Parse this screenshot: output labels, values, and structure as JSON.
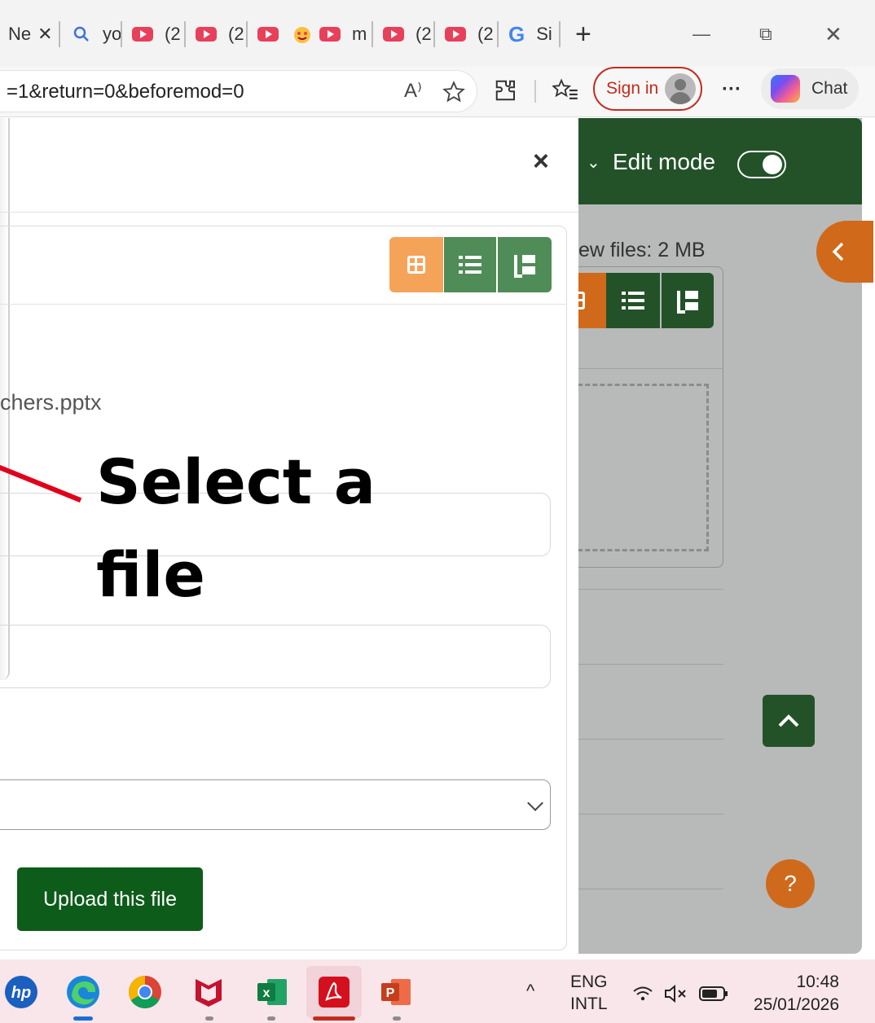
{
  "browser": {
    "tabs": [
      {
        "label": "Ne",
        "icon": "page-icon",
        "active": true
      },
      {
        "label": "yo",
        "icon": "search-icon"
      },
      {
        "label": "(2",
        "icon": "youtube-icon"
      },
      {
        "label": "(2",
        "icon": "youtube-icon"
      },
      {
        "label": "",
        "icon": "youtube-icon"
      },
      {
        "label": "",
        "icon": "emoji-icon"
      },
      {
        "label": "m",
        "icon": "youtube-icon"
      },
      {
        "label": "(2",
        "icon": "youtube-icon"
      },
      {
        "label": "(2",
        "icon": "youtube-icon"
      },
      {
        "label": "Si",
        "icon": "google-icon"
      }
    ],
    "new_tab_label": "+",
    "window_controls": {
      "minimize": "—",
      "restore": "⧉",
      "close": "✕"
    },
    "tab_close": "✕",
    "url": "=1&return=0&beforemod=0",
    "read_aloud": "A⁾",
    "sign_in_label": "Sign in",
    "more_label": "···",
    "chat_label": "Chat"
  },
  "background_page": {
    "edit_mode_label": "Edit mode",
    "edit_mode_on": true,
    "max_files_text": "ew files: 2 MB",
    "collapse_icon": "chevron-left-icon",
    "scroll_top_icon": "chevron-up-icon",
    "help_label": "?"
  },
  "dialog": {
    "close_label": "×",
    "filename_partial": "chers.pptx",
    "upload_button_label": "Upload this file",
    "license_select_value": ""
  },
  "annotation": {
    "text": "Select a file",
    "color": "#e0001b"
  },
  "colors": {
    "moodle_green": "#235229",
    "view_active_orange": "#f6a35a",
    "view_inactive_green": "#4f8c57",
    "upload_green": "#0d5c1a",
    "accent_orange": "#d0691a"
  },
  "taskbar": {
    "apps": [
      "hp-icon",
      "edge-icon",
      "chrome-icon",
      "mcafee-icon",
      "excel-icon",
      "acrobat-icon",
      "powerpoint-icon"
    ],
    "tray_chevron": "^",
    "lang_line1": "ENG",
    "lang_line2": "INTL",
    "time": "10:48",
    "date": "25/01/2026"
  }
}
